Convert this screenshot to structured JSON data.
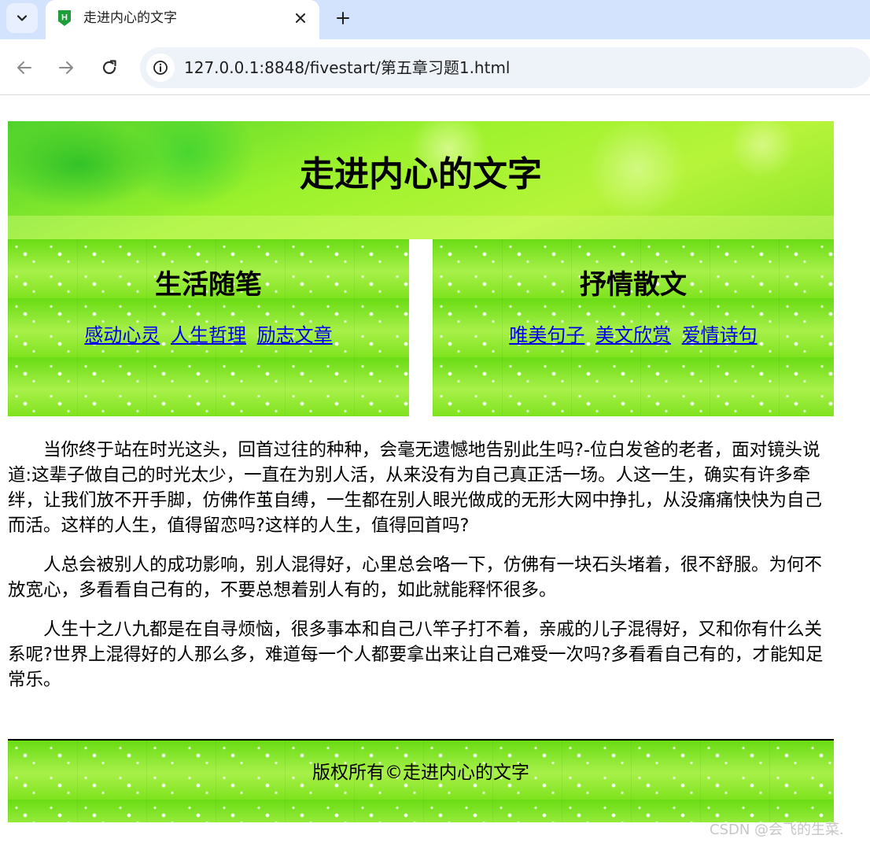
{
  "browser": {
    "tab": {
      "favicon_letter": "H",
      "title": "走进内心的文字"
    },
    "address_bar": {
      "url": "127.0.0.1:8848/fivestart/第五章习题1.html"
    },
    "icons": {
      "tab_menu": "chevron-down-icon",
      "close_tab": "close-icon",
      "new_tab": "plus-icon",
      "back": "arrow-left-icon",
      "forward": "arrow-right-icon",
      "reload": "reload-icon",
      "site_info": "info-icon"
    }
  },
  "page": {
    "header": {
      "title": "走进内心的文字"
    },
    "panels": [
      {
        "title": "生活随笔",
        "links": [
          "感动心灵",
          "人生哲理",
          "励志文章"
        ]
      },
      {
        "title": "抒情散文",
        "links": [
          "唯美句子",
          "美文欣赏",
          "爱情诗句"
        ]
      }
    ],
    "paragraphs": [
      "当你终于站在时光这头，回首过往的种种，会毫无遗憾地告别此生吗?-位白发爸的老者，面对镜头说道:这辈子做自己的时光太少，一直在为别人活，从来没有为自己真正活一场。人这一生，确实有许多牵绊，让我们放不开手脚，仿佛作茧自缚，一生都在别人眼光做成的无形大网中挣扎，从没痛痛快快为自己而活。这样的人生，值得留恋吗?这样的人生，值得回首吗?",
      "人总会被别人的成功影响，别人混得好，心里总会咯一下，仿佛有一块石头堵着，很不舒服。为何不放宽心，多看看自己有的，不要总想着别人有的，如此就能释怀很多。",
      "人生十之八九都是在自寻烦恼，很多事本和自己八竿子打不着，亲戚的儿子混得好，又和你有什么关系呢?世界上混得好的人那么多，难道每一个人都要拿出来让自己难受一次吗?多看看自己有的，才能知足常乐。"
    ],
    "footer": {
      "text": "版权所有©走进内心的文字"
    }
  },
  "watermark": "CSDN @会飞的生菜.",
  "colors": {
    "tabbar_bg": "#d3e3fd",
    "link": "#0000ee",
    "green_bg": "#7fe31e",
    "favicon_green": "#1e9e3a"
  }
}
